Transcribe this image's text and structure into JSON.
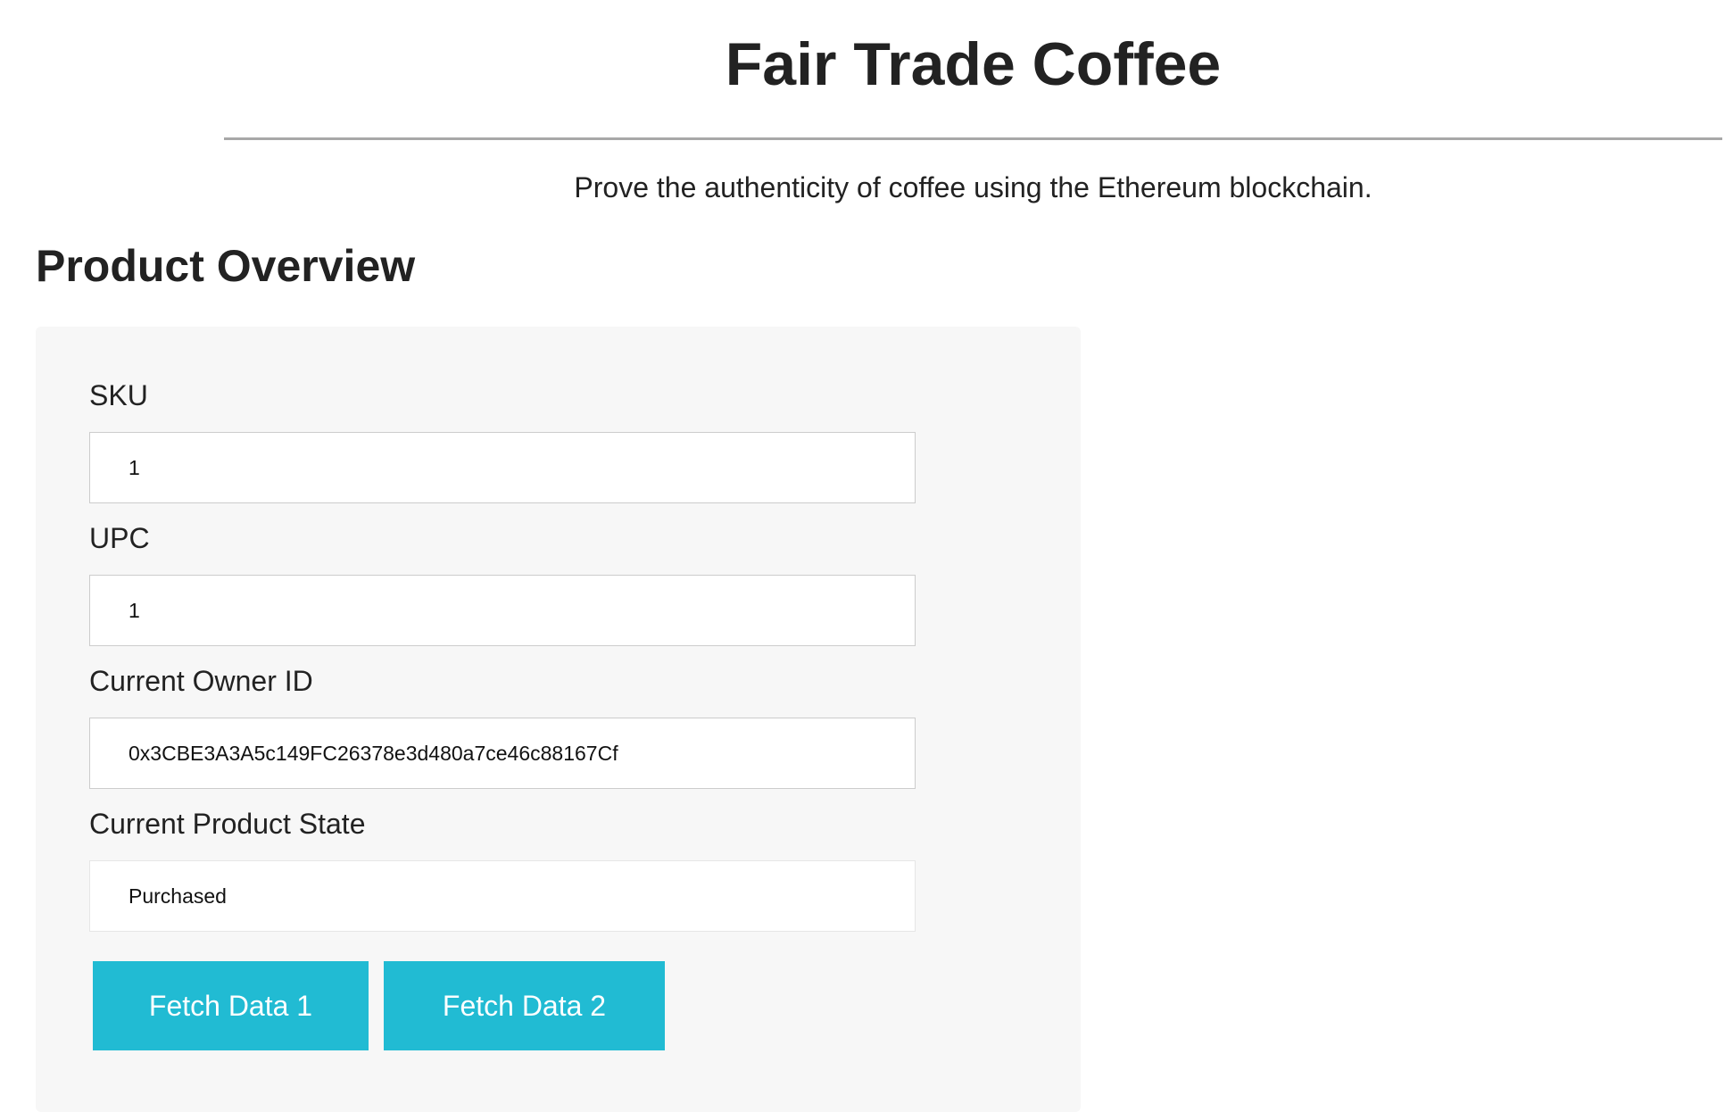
{
  "header": {
    "title": "Fair Trade Coffee",
    "tagline": "Prove the authenticity of coffee using the Ethereum blockchain."
  },
  "overview": {
    "title": "Product Overview",
    "fields": {
      "sku": {
        "label": "SKU",
        "value": "1"
      },
      "upc": {
        "label": "UPC",
        "value": "1"
      },
      "owner": {
        "label": "Current Owner ID",
        "value": "0x3CBE3A3A5c149FC26378e3d480a7ce46c88167Cf"
      },
      "state": {
        "label": "Current Product State",
        "value": "Purchased"
      }
    },
    "buttons": {
      "fetch1": "Fetch Data 1",
      "fetch2": "Fetch Data 2"
    }
  },
  "colors": {
    "accent": "#21bbd3",
    "panel_bg": "#f7f7f7",
    "divider": "#a8a8a8"
  }
}
